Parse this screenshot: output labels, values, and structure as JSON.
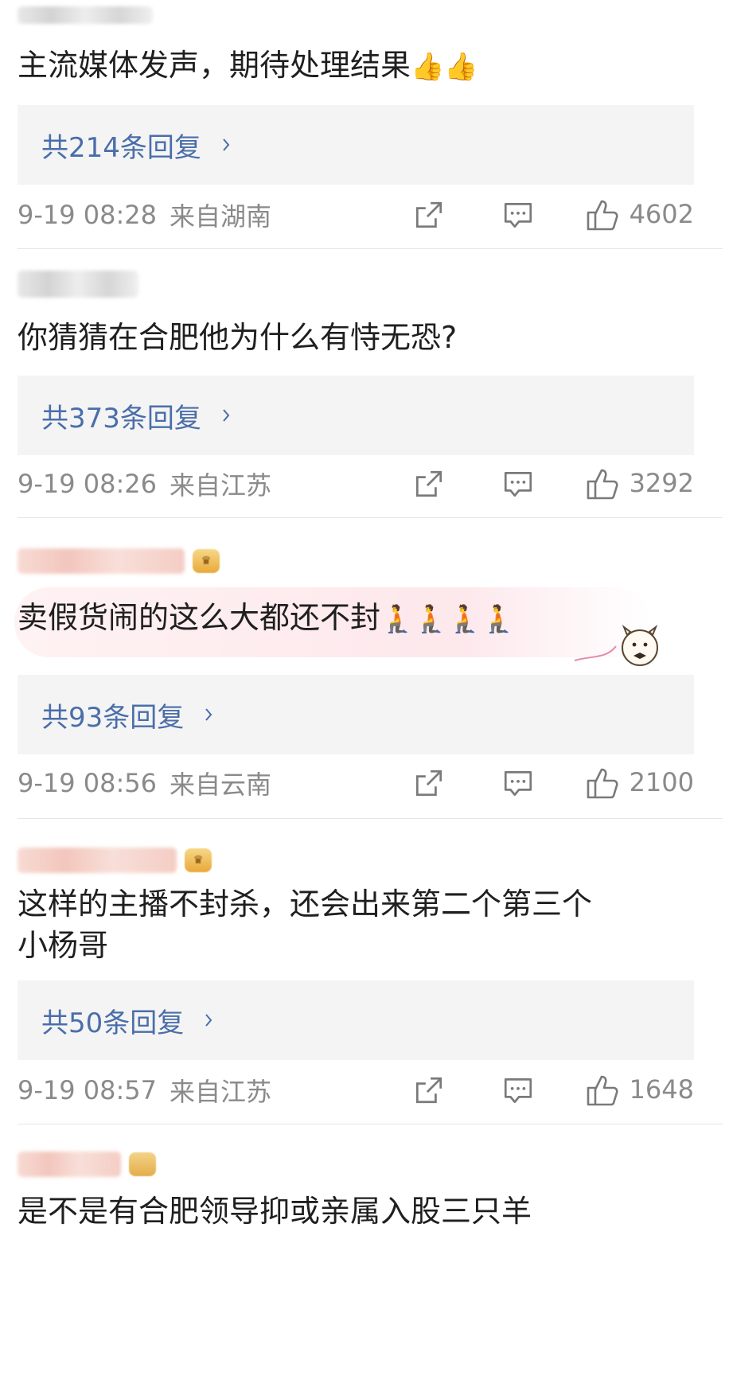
{
  "comments": [
    {
      "text": "主流媒体发声，期待处理结果",
      "emojis": "👍👍",
      "replies": "共214条回复",
      "time": "9-19 08:28",
      "location": "来自湖南",
      "likes": "4602"
    },
    {
      "text": "你猜猜在合肥他为什么有恃无恐?",
      "emojis": "",
      "replies": "共373条回复",
      "time": "9-19 08:26",
      "location": "来自江苏",
      "likes": "3292"
    },
    {
      "text": "卖假货闹的这么大都还不封",
      "emojis": "🧎🧎🧎🧎",
      "replies": "共93条回复",
      "time": "9-19 08:56",
      "location": "来自云南",
      "likes": "2100"
    },
    {
      "text": "这样的主播不封杀，还会出来第二个第三个\n小杨哥",
      "emojis": "",
      "replies": "共50条回复",
      "time": "9-19 08:57",
      "location": "来自江苏",
      "likes": "1648"
    },
    {
      "text": "是不是有合肥领导抑或亲属入股三只羊",
      "emojis": ""
    }
  ],
  "icons": {
    "share": "share-icon",
    "reply": "comment-icon",
    "like": "thumbs-up-icon",
    "chevron": "chevron-right-icon"
  },
  "colors": {
    "link": "#4a6ea9",
    "meta": "#8a8a8a",
    "reply_bg": "#f4f4f4"
  }
}
